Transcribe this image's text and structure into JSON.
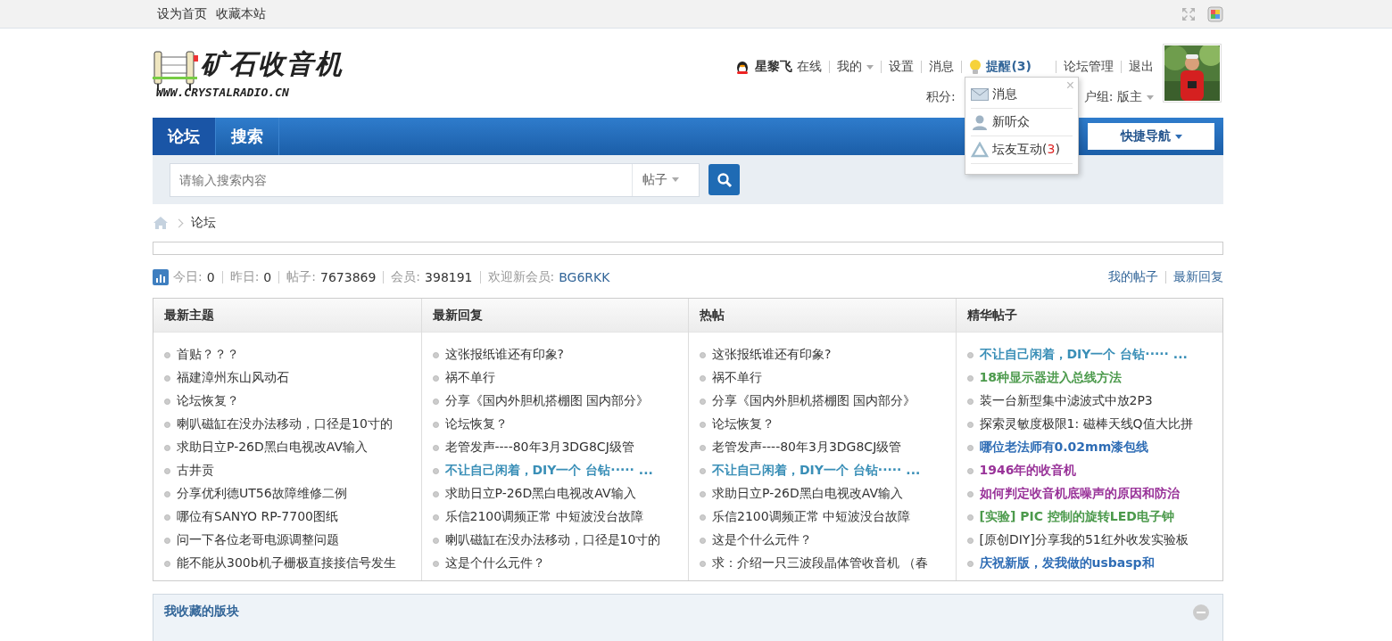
{
  "top_bar": {
    "links": [
      "设为首页",
      "收藏本站"
    ]
  },
  "logo": {
    "title": "矿石收音机",
    "url": "WWW.CRYSTALRADIO.CN"
  },
  "user": {
    "name": "星黎飞",
    "status": "在线",
    "menu": [
      {
        "label": "我的",
        "dropdown": true
      },
      {
        "label": "设置",
        "dropdown": false
      },
      {
        "label": "消息",
        "dropdown": false
      }
    ],
    "reminder": "提醒(3)",
    "links": [
      "论坛管理",
      "退出"
    ],
    "points_label": "积分:",
    "group": "户组: 版主"
  },
  "reminder_popup": {
    "items": [
      {
        "kind": "mail",
        "label": "消息"
      },
      {
        "kind": "person",
        "label": "新听众"
      },
      {
        "kind": "interact",
        "label": "坛友互动(",
        "count": "3",
        "suffix": ")"
      }
    ],
    "close": "×"
  },
  "nav": {
    "tabs": [
      {
        "label": "论坛",
        "selected": true
      },
      {
        "label": "搜索",
        "selected": false
      }
    ],
    "quick_nav": "快捷导航"
  },
  "search": {
    "placeholder": "请输入搜索内容",
    "type": "帖子"
  },
  "breadcrumb": [
    "论坛"
  ],
  "stats": [
    {
      "label": "今日:",
      "value": "0"
    },
    {
      "label": "昨日:",
      "value": "0"
    },
    {
      "label": "帖子:",
      "value": "7673869"
    },
    {
      "label": "会员:",
      "value": "398191"
    },
    {
      "label": "欢迎新会员:",
      "value": "BG6RKK"
    }
  ],
  "stats_links": [
    "我的帖子",
    "最新回复"
  ],
  "columns": [
    {
      "title": "最新主题",
      "items": [
        {
          "text": "首贴？？？"
        },
        {
          "text": "福建漳州东山风动石"
        },
        {
          "text": "论坛恢复？"
        },
        {
          "text": "喇叭磁缸在没办法移动，口径是10寸的"
        },
        {
          "text": "求助日立P-26D黑白电视改AV输入"
        },
        {
          "text": "古井贡"
        },
        {
          "text": "分享优利德UT56故障维修二例"
        },
        {
          "text": "哪位有SANYO RP-7700图纸"
        },
        {
          "text": "问一下各位老哥电源调整问题"
        },
        {
          "text": "能不能从300b机子栅极直接接信号发生"
        }
      ]
    },
    {
      "title": "最新回复",
      "items": [
        {
          "text": "这张报纸谁还有印象?"
        },
        {
          "text": "祸不单行"
        },
        {
          "text": "分享《国内外胆机搭棚图 国内部分》"
        },
        {
          "text": "论坛恢复？"
        },
        {
          "text": "老管发声----80年3月3DG8CJ级管"
        },
        {
          "text": "不让自己闲着，DIY一个 台钻····· ...",
          "color": "#3a8fb7"
        },
        {
          "text": "求助日立P-26D黑白电视改AV输入"
        },
        {
          "text": "乐信2100调频正常 中短波没台故障"
        },
        {
          "text": "喇叭磁缸在没办法移动，口径是10寸的"
        },
        {
          "text": "这是个什么元件？"
        }
      ]
    },
    {
      "title": "热帖",
      "items": [
        {
          "text": "这张报纸谁还有印象?"
        },
        {
          "text": "祸不单行"
        },
        {
          "text": "分享《国内外胆机搭棚图 国内部分》"
        },
        {
          "text": "论坛恢复？"
        },
        {
          "text": "老管发声----80年3月3DG8CJ级管"
        },
        {
          "text": "不让自己闲着，DIY一个 台钻····· ...",
          "color": "#3a8fb7"
        },
        {
          "text": "求助日立P-26D黑白电视改AV输入"
        },
        {
          "text": "乐信2100调频正常 中短波没台故障"
        },
        {
          "text": "这是个什么元件？"
        },
        {
          "text": "求：介绍一只三波段晶体管收音机 （春"
        }
      ]
    },
    {
      "title": "精华帖子",
      "items": [
        {
          "text": "不让自己闲着，DIY一个 台钻····· ...",
          "color": "#3a8fb7"
        },
        {
          "text": "18种显示器进入总线方法",
          "color": "#4c9a4c"
        },
        {
          "text": "装一台新型集中滤波式中放2P3"
        },
        {
          "text": "探索灵敏度极限1: 磁棒天线Q值大比拼"
        },
        {
          "text": "哪位老法师有0.02mm漆包线",
          "color": "#2f6db5"
        },
        {
          "text": "1946年的收音机",
          "color": "#993399"
        },
        {
          "text": "如何判定收音机底噪声的原因和防治",
          "color": "#993399"
        },
        {
          "text": "[实验] PIC 控制的旋转LED电子钟",
          "color": "#4c9a4c"
        },
        {
          "text": "[原创DIY]分享我的51红外收发实验板"
        },
        {
          "text": "庆祝新版，发我做的usbasp和",
          "color": "#2f6db5"
        }
      ]
    }
  ],
  "favorites": {
    "title": "我收藏的版块"
  }
}
